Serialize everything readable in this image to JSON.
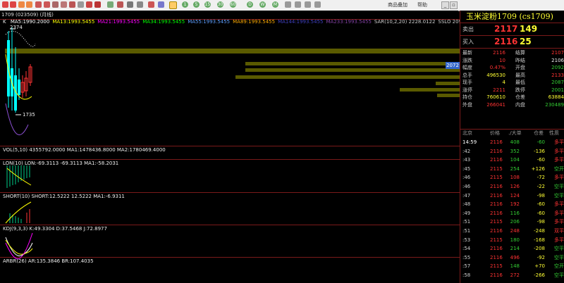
{
  "toolbar": {
    "right_links": [
      "商品叠加",
      "帮助"
    ],
    "numbers": [
      "1",
      "5",
      "15",
      "30",
      "60",
      "D",
      "W",
      "M"
    ]
  },
  "title": "1709 (023509) (月线)",
  "indicators": {
    "ma": {
      "label": "K",
      "items": [
        {
          "text": "MA5:1990.2000",
          "color": "#ffffff"
        },
        {
          "text": "MA13:1993.5455",
          "color": "#ffff00"
        },
        {
          "text": "MA21:1993.5455",
          "color": "#ff00ff"
        },
        {
          "text": "MA34:1993.5455",
          "color": "#00ff00"
        },
        {
          "text": "MA55:1993.5455",
          "color": "#5f9fff"
        },
        {
          "text": "MA89:1993.5455",
          "color": "#ffaa00"
        },
        {
          "text": "MA144:1993.5455",
          "color": "#4040c0"
        },
        {
          "text": "MA233:1993.5455",
          "color": "#8040a0"
        },
        {
          "text": "SAR(10,2,20) 2228.0122",
          "color": "#cccccc"
        },
        {
          "text": "SSLO 2090.7",
          "color": "#cccccc"
        }
      ]
    },
    "vol": "VOL(5,10) 4355792.0000 MA1:1478436.8000 MA2:1780469.4000",
    "lon": "LON(10) LON:-69.3113 -69.3113 MA1:-58.2031",
    "short": "SHORT(10) SHORT:12.5222 12.5222 MA1:-6.9311",
    "kdj": "KDJ(9,3,3) K:49.3304 D:37.5468 J:72.8977",
    "arbr": "ARBR(26) AR:135.3846 BR:107.4035"
  },
  "price_marks": {
    "high": "2374",
    "low": "1735",
    "current": "2072"
  },
  "quote": {
    "title": "玉米淀粉1709 (cs1709)",
    "sell": {
      "label": "卖出",
      "price": "2117",
      "vol": "149"
    },
    "buy": {
      "label": "买入",
      "price": "2116",
      "vol": "25"
    }
  },
  "stats": [
    {
      "a": "最新",
      "b": "2116",
      "bc": "red",
      "c": "结算",
      "d": "2107",
      "dc": "red"
    },
    {
      "a": "涨跌",
      "b": "10",
      "bc": "red",
      "c": "昨结",
      "d": "2106",
      "dc": "white"
    },
    {
      "a": "幅度",
      "b": "0.47%",
      "bc": "red",
      "c": "开盘",
      "d": "2092",
      "dc": "green"
    },
    {
      "a": "总手",
      "b": "496530",
      "bc": "yellow",
      "c": "最高",
      "d": "2133",
      "dc": "red"
    },
    {
      "a": "现手",
      "b": "4",
      "bc": "yellow",
      "c": "最低",
      "d": "2087",
      "dc": "green"
    },
    {
      "a": "涨停",
      "b": "2211",
      "bc": "red",
      "c": "跌停",
      "d": "2001",
      "dc": "green"
    },
    {
      "a": "持仓",
      "b": "760610",
      "bc": "yellow",
      "c": "仓差",
      "d": "63884",
      "dc": "yellow"
    },
    {
      "a": "外盘",
      "b": "266041",
      "bc": "red",
      "c": "内盘",
      "d": "230489",
      "dc": "green"
    }
  ],
  "ticks_header": [
    "北京",
    "价格",
    "./大单",
    "仓差",
    "性质"
  ],
  "ticks": [
    {
      "t": "14:59",
      "p": "2116",
      "v": "408",
      "d": "-60",
      "n": "多平",
      "pc": "red",
      "vc": "green",
      "dc": "green",
      "nc": "red"
    },
    {
      "t": ":42",
      "p": "2116",
      "v": "352",
      "d": "-136",
      "n": "多平",
      "pc": "red",
      "vc": "green",
      "dc": "yellow",
      "nc": "red"
    },
    {
      "t": ":43",
      "p": "2116",
      "v": "104",
      "d": "-60",
      "n": "多平",
      "pc": "red",
      "vc": "green",
      "dc": "yellow",
      "nc": "red"
    },
    {
      "t": ":45",
      "p": "2115",
      "v": "254",
      "d": "+126",
      "n": "空开",
      "pc": "red",
      "vc": "green",
      "dc": "yellow",
      "nc": "green"
    },
    {
      "t": ":46",
      "p": "2115",
      "v": "108",
      "d": "-72",
      "n": "多平",
      "pc": "red",
      "vc": "red",
      "dc": "yellow",
      "nc": "red"
    },
    {
      "t": ":46",
      "p": "2116",
      "v": "126",
      "d": "-22",
      "n": "空平",
      "pc": "red",
      "vc": "red",
      "dc": "yellow",
      "nc": "green"
    },
    {
      "t": ":47",
      "p": "2116",
      "v": "124",
      "d": "-98",
      "n": "空平",
      "pc": "red",
      "vc": "red",
      "dc": "yellow",
      "nc": "green"
    },
    {
      "t": ":48",
      "p": "2116",
      "v": "192",
      "d": "-60",
      "n": "多平",
      "pc": "red",
      "vc": "red",
      "dc": "yellow",
      "nc": "red"
    },
    {
      "t": ":49",
      "p": "2116",
      "v": "116",
      "d": "-60",
      "n": "多平",
      "pc": "red",
      "vc": "green",
      "dc": "yellow",
      "nc": "red"
    },
    {
      "t": ":51",
      "p": "2115",
      "v": "206",
      "d": "-98",
      "n": "多平",
      "pc": "red",
      "vc": "green",
      "dc": "yellow",
      "nc": "red"
    },
    {
      "t": ":51",
      "p": "2116",
      "v": "248",
      "d": "-248",
      "n": "双平",
      "pc": "red",
      "vc": "red",
      "dc": "yellow",
      "nc": "red"
    },
    {
      "t": ":53",
      "p": "2115",
      "v": "180",
      "d": "-168",
      "n": "多平",
      "pc": "red",
      "vc": "green",
      "dc": "yellow",
      "nc": "red"
    },
    {
      "t": ":54",
      "p": "2116",
      "v": "214",
      "d": "-208",
      "n": "空平",
      "pc": "red",
      "vc": "green",
      "dc": "yellow",
      "nc": "green"
    },
    {
      "t": ":55",
      "p": "2116",
      "v": "496",
      "d": "-92",
      "n": "空平",
      "pc": "red",
      "vc": "red",
      "dc": "yellow",
      "nc": "green"
    },
    {
      "t": ":57",
      "p": "2115",
      "v": "148",
      "d": "+70",
      "n": "空开",
      "pc": "red",
      "vc": "green",
      "dc": "yellow",
      "nc": "green"
    },
    {
      "t": ":58",
      "p": "2116",
      "v": "272",
      "d": "-266",
      "n": "空平",
      "pc": "red",
      "vc": "red",
      "dc": "yellow",
      "nc": "green"
    }
  ]
}
